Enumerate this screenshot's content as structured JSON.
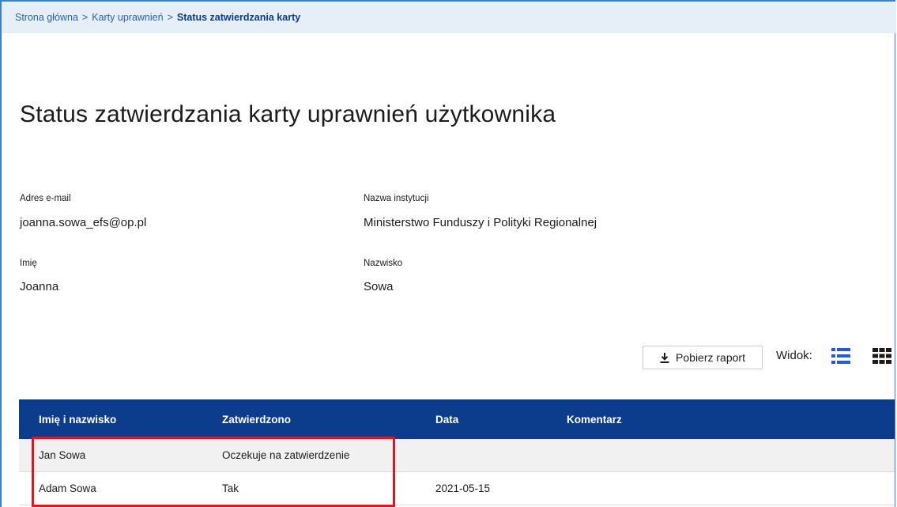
{
  "breadcrumb": {
    "home": "Strona główna",
    "cards": "Karty uprawnień",
    "current": "Status zatwierdzania karty",
    "separator": ">"
  },
  "page": {
    "title": "Status zatwierdzania karty uprawnień użytkownika"
  },
  "fields": {
    "email": {
      "label": "Adres e-mail",
      "value": "joanna.sowa_efs@op.pl"
    },
    "institution": {
      "label": "Nazwa instytucji",
      "value": "Ministerstwo Funduszy i Polityki Regionalnej"
    },
    "first_name": {
      "label": "Imię",
      "value": "Joanna"
    },
    "last_name": {
      "label": "Nazwisko",
      "value": "Sowa"
    }
  },
  "toolbar": {
    "download_label": "Pobierz raport",
    "view_label": "Widok:"
  },
  "table": {
    "columns": [
      "Imię i nazwisko",
      "Zatwierdzono",
      "Data",
      "Komentarz"
    ],
    "rows": [
      [
        "Jan Sowa",
        "Oczekuje na zatwierdzenie",
        "",
        ""
      ],
      [
        "Adam Sowa",
        "Tak",
        "2021-05-15",
        ""
      ]
    ]
  },
  "colors": {
    "header_bg": "#0b3d8c",
    "breadcrumb_bg": "#e6eef8",
    "highlight": "#e3131f",
    "frame": "#3d7fc8"
  },
  "icons": {
    "download": "download-icon",
    "list_view": "list-view-icon",
    "grid_view": "grid-view-icon"
  }
}
